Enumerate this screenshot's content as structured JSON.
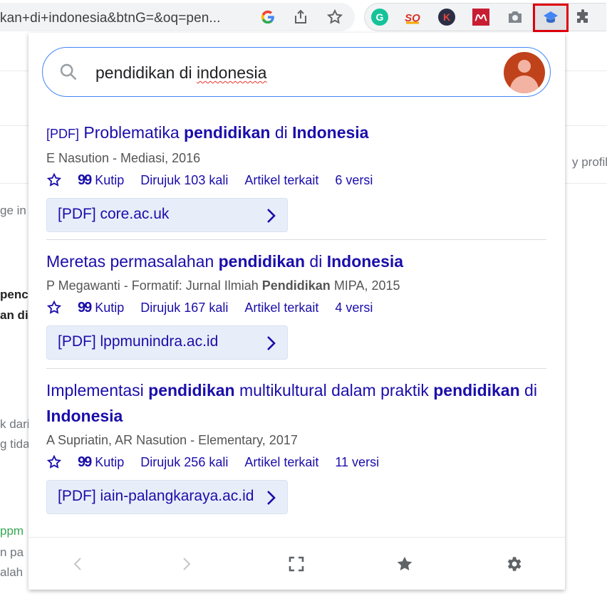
{
  "browser": {
    "url": "kan+di+indonesia&btnG=&oq=pen...",
    "icons": [
      "google-icon",
      "share-icon",
      "bookmark-star-icon"
    ],
    "extensions": [
      "grammarly-icon",
      "sq-icon",
      "k-icon",
      "mendeley-icon",
      "camera-icon",
      "scholar-cap-icon",
      "puzzle-icon"
    ]
  },
  "background": {
    "fragments": [
      "y profile",
      "ge in",
      "penc",
      "an di",
      "k dari",
      "g tida",
      "ppm",
      "n pa",
      "alah"
    ]
  },
  "popup": {
    "search": {
      "query_prefix": "pendidikan di ",
      "query_misspelled": "indonesia"
    },
    "results": [
      {
        "pdf_tag": "[PDF]",
        "title_parts": [
          "Problematika ",
          "pendidikan",
          " di ",
          "Indonesia"
        ],
        "meta_parts": [
          "E Nasution - Mediasi, 2016"
        ],
        "star": "☆",
        "cite_label": "Kutip",
        "cited_by": "Dirujuk 103 kali",
        "related": "Artikel terkait",
        "versions": "6 versi",
        "link_label": "[PDF] core.ac.uk"
      },
      {
        "pdf_tag": "",
        "title_parts": [
          "Meretas permasalahan ",
          "pendidikan",
          " di ",
          "Indonesia"
        ],
        "meta_parts": [
          "P Megawanti - Formatif: Jurnal Ilmiah ",
          "Pendidikan",
          " MIPA, 2015"
        ],
        "star": "☆",
        "cite_label": "Kutip",
        "cited_by": "Dirujuk 167 kali",
        "related": "Artikel terkait",
        "versions": "4 versi",
        "link_label": "[PDF] lppmunindra.ac.id"
      },
      {
        "pdf_tag": "",
        "title_parts": [
          "Implementasi ",
          "pendidikan",
          " multikultural dalam praktik ",
          "pendidikan",
          " di ",
          "Indonesia"
        ],
        "meta_parts": [
          "A Supriatin, AR Nasution - Elementary, 2017"
        ],
        "star": "☆",
        "cite_label": "Kutip",
        "cited_by": "Dirujuk 256 kali",
        "related": "Artikel terkait",
        "versions": "11 versi",
        "link_label": "[PDF] iain-palangkaraya.ac.id"
      }
    ],
    "footer": [
      "prev-icon",
      "next-icon",
      "fullscreen-icon",
      "starred-icon",
      "settings-icon"
    ]
  },
  "colors": {
    "link": "#1a0dab",
    "search_border": "#4285f4",
    "highlight_box": "#e0000b",
    "avatar": "#c0421a"
  }
}
